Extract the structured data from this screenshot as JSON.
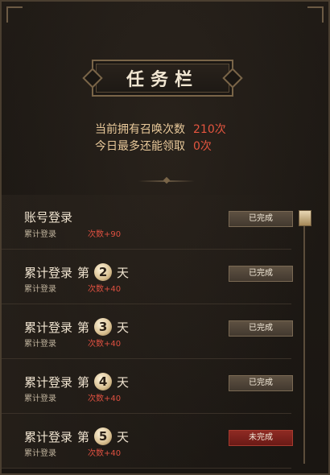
{
  "header": {
    "title": "任务栏"
  },
  "stats": {
    "owned_label": "当前拥有召唤次数",
    "owned_value": "210次",
    "remaining_label": "今日最多还能领取",
    "remaining_value": "0次"
  },
  "tasks": [
    {
      "title": "账号登录",
      "day": "",
      "subtitle": "累计登录",
      "reward": "次数+90",
      "status": "已完成",
      "status_color": "#5e5142"
    },
    {
      "title": "累计登录",
      "prefix": "第",
      "day": "2",
      "suffix": "天",
      "subtitle": "累计登录",
      "reward": "次数+40",
      "status": "已完成",
      "status_color": "#5e5142"
    },
    {
      "title": "累计登录",
      "prefix": "第",
      "day": "3",
      "suffix": "天",
      "subtitle": "累计登录",
      "reward": "次数+40",
      "status": "已完成",
      "status_color": "#5e5142"
    },
    {
      "title": "累计登录",
      "prefix": "第",
      "day": "4",
      "suffix": "天",
      "subtitle": "累计登录",
      "reward": "次数+40",
      "status": "已完成",
      "status_color": "#5e5142"
    },
    {
      "title": "累计登录",
      "prefix": "第",
      "day": "5",
      "suffix": "天",
      "subtitle": "累计登录",
      "reward": "次数+40",
      "status": "未完成",
      "status_color": "#8e2a23"
    }
  ],
  "colors": {
    "accent_red": "#e4553f",
    "label_gold": "#e9c99a"
  }
}
